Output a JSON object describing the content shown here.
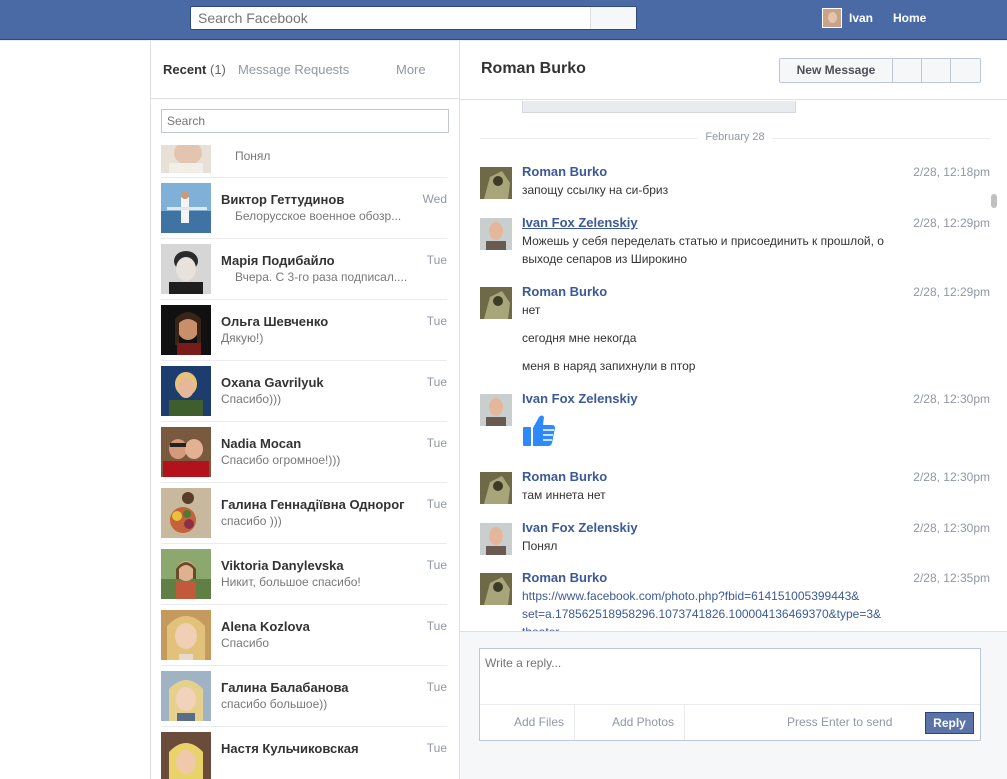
{
  "topbar": {
    "search_placeholder": "Search Facebook",
    "user_name": "Ivan",
    "home_label": "Home"
  },
  "list": {
    "tab_recent": "Recent",
    "tab_recent_count": "(1)",
    "tab_requests": "Message Requests",
    "tab_more": "More",
    "search_placeholder": "Search",
    "threads": [
      {
        "name": "",
        "snippet": "Понял",
        "time": ""
      },
      {
        "name": "Виктор Геттудинов",
        "snippet": "Белорусское военное обозр...",
        "time": "Wed"
      },
      {
        "name": "Марія Подибайло",
        "snippet": "Вчера. С 3-го раза подписал....",
        "time": "Tue"
      },
      {
        "name": "Ольга Шевченко",
        "snippet": "Дякую!)",
        "time": "Tue"
      },
      {
        "name": "Oxana Gavrilyuk",
        "snippet": "Спасибо)))",
        "time": "Tue"
      },
      {
        "name": "Nadia Mocan",
        "snippet": "Спасибо огромное!)))",
        "time": "Tue"
      },
      {
        "name": "Галина Геннадіївна Однорог",
        "snippet": "спасибо )))",
        "time": "Tue"
      },
      {
        "name": "Viktoria Danylevska",
        "snippet": "Никит, большое спасибо!",
        "time": "Tue"
      },
      {
        "name": "Alena Kozlova",
        "snippet": "Спасибо",
        "time": "Tue"
      },
      {
        "name": "Галина Балабанова",
        "snippet": "спасибо большое))",
        "time": "Tue"
      },
      {
        "name": "Настя Кульчиковская",
        "snippet": "",
        "time": "Tue"
      }
    ]
  },
  "conversation": {
    "title": "Roman Burko",
    "new_message_label": "New Message",
    "date_divider": "February 28",
    "messages": [
      {
        "author": "Roman Burko",
        "time": "2/28, 12:18pm",
        "lines": [
          "запощу ссылку на си-бриз"
        ]
      },
      {
        "author": "Ivan Fox Zelenskiy",
        "time": "2/28, 12:29pm",
        "lines": [
          "Можешь у себя переделать статью и присоединить к прошлой, о",
          "выходе сепаров из Широкино"
        ]
      },
      {
        "author": "Roman Burko",
        "time": "2/28, 12:29pm",
        "lines": [
          "нет",
          "сегодня мне некогда",
          "меня в наряд запихнули в птор"
        ]
      },
      {
        "author": "Ivan Fox Zelenskiy",
        "time": "2/28, 12:30pm",
        "lines": []
      },
      {
        "author": "Roman Burko",
        "time": "2/28, 12:30pm",
        "lines": [
          "там иннета нет"
        ]
      },
      {
        "author": "Ivan Fox Zelenskiy",
        "time": "2/28, 12:30pm",
        "lines": [
          "Понял"
        ]
      },
      {
        "author": "Roman Burko",
        "time": "2/28, 12:35pm",
        "lines": [
          "https://www.facebook.com/photo.php?fbid=614151005399443&",
          "set=a.178562518958296.1073741826.100004136469370&type=3&",
          "theater"
        ]
      }
    ]
  },
  "composer": {
    "placeholder": "Write a reply...",
    "add_files": "Add Files",
    "add_photos": "Add Photos",
    "press_enter": "Press Enter to send",
    "reply_label": "Reply"
  },
  "icons": {
    "like": "thumbs-up-icon",
    "avatar": "avatar"
  },
  "colors": {
    "topbar": "#4a6aa5",
    "link": "#3b5998",
    "reply_button": "#5b74a8",
    "like_icon": "#2e89ff"
  }
}
